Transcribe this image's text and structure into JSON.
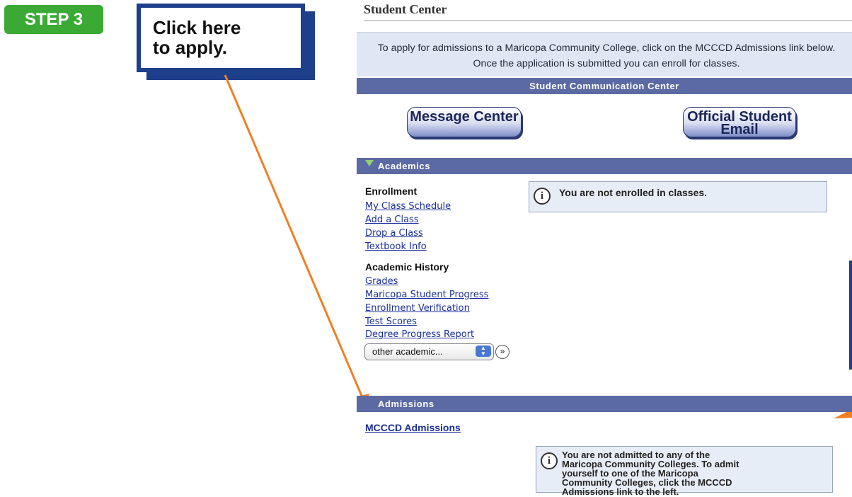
{
  "annotation": {
    "step_label": "STEP 3",
    "callout_text": "Click here\nto apply.",
    "accent_color": "#f07f23"
  },
  "page": {
    "title": "Student Center",
    "intro": "To apply for admissions to a Maricopa Community College, click on the MCCCD Admissions link below. Once the application is submitted you can enroll for classes."
  },
  "communication": {
    "header": "Student Communication Center",
    "message_center": "Message Center",
    "official_email": "Official Student Email"
  },
  "academics": {
    "header": "Academics",
    "enrollment_title": "Enrollment",
    "enrollment_links": [
      "My Class Schedule",
      "Add a Class",
      "Drop a Class",
      "Textbook Info"
    ],
    "history_title": "Academic History",
    "history_links": [
      "Grades",
      "Maricopa Student Progress",
      "Enrollment Verification",
      "Test Scores",
      "Degree Progress Report"
    ],
    "other_select": "other academic...",
    "enrolled_message": "You are not enrolled in classes."
  },
  "admissions": {
    "header": "Admissions",
    "link": "MCCCD Admissions",
    "message": "You are not admitted to any of the Maricopa Community Colleges. To admit yourself to one of the Maricopa Community Colleges, click the MCCCD Admissions link to the left."
  }
}
